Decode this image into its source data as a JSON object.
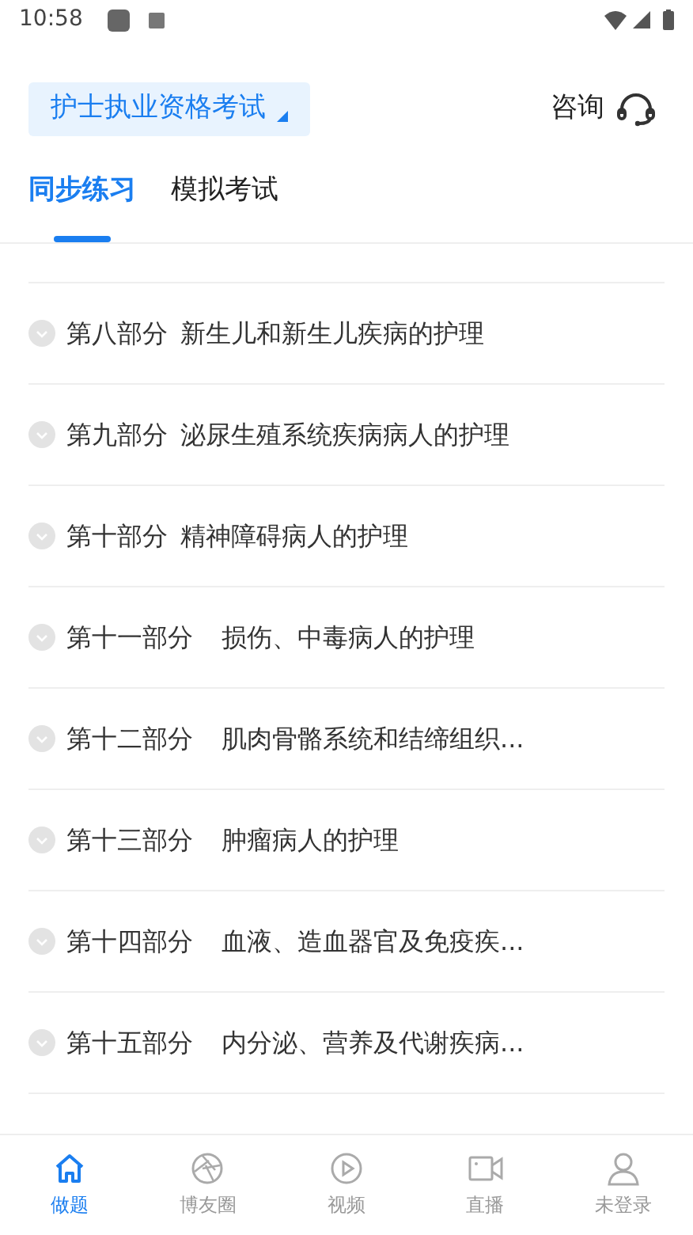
{
  "status_bar": {
    "time": "10:58"
  },
  "header": {
    "exam_selector": "护士执业资格考试",
    "consult": "咨询"
  },
  "tabs": [
    {
      "label": "同步练习",
      "selected": true
    },
    {
      "label": "模拟考试",
      "selected": false
    }
  ],
  "chapters": [
    {
      "part": "第八部分",
      "title": "新生儿和新生儿疾病的护理"
    },
    {
      "part": "第九部分",
      "title": "泌尿生殖系统疾病病人的护理"
    },
    {
      "part": "第十部分",
      "title": "精神障碍病人的护理"
    },
    {
      "part": "第十一部分",
      "title": "损伤、中毒病人的护理"
    },
    {
      "part": "第十二部分",
      "title": "肌肉骨骼系统和结缔组织..."
    },
    {
      "part": "第十三部分",
      "title": "肿瘤病人的护理"
    },
    {
      "part": "第十四部分",
      "title": "血液、造血器官及免疫疾..."
    },
    {
      "part": "第十五部分",
      "title": "内分泌、营养及代谢疾病..."
    }
  ],
  "bottom_nav": [
    {
      "label": "做题",
      "kind": "home",
      "selected": true
    },
    {
      "label": "博友圈",
      "kind": "aperture",
      "selected": false
    },
    {
      "label": "视频",
      "kind": "play",
      "selected": false
    },
    {
      "label": "直播",
      "kind": "camera",
      "selected": false
    },
    {
      "label": "未登录",
      "kind": "person",
      "selected": false
    }
  ]
}
